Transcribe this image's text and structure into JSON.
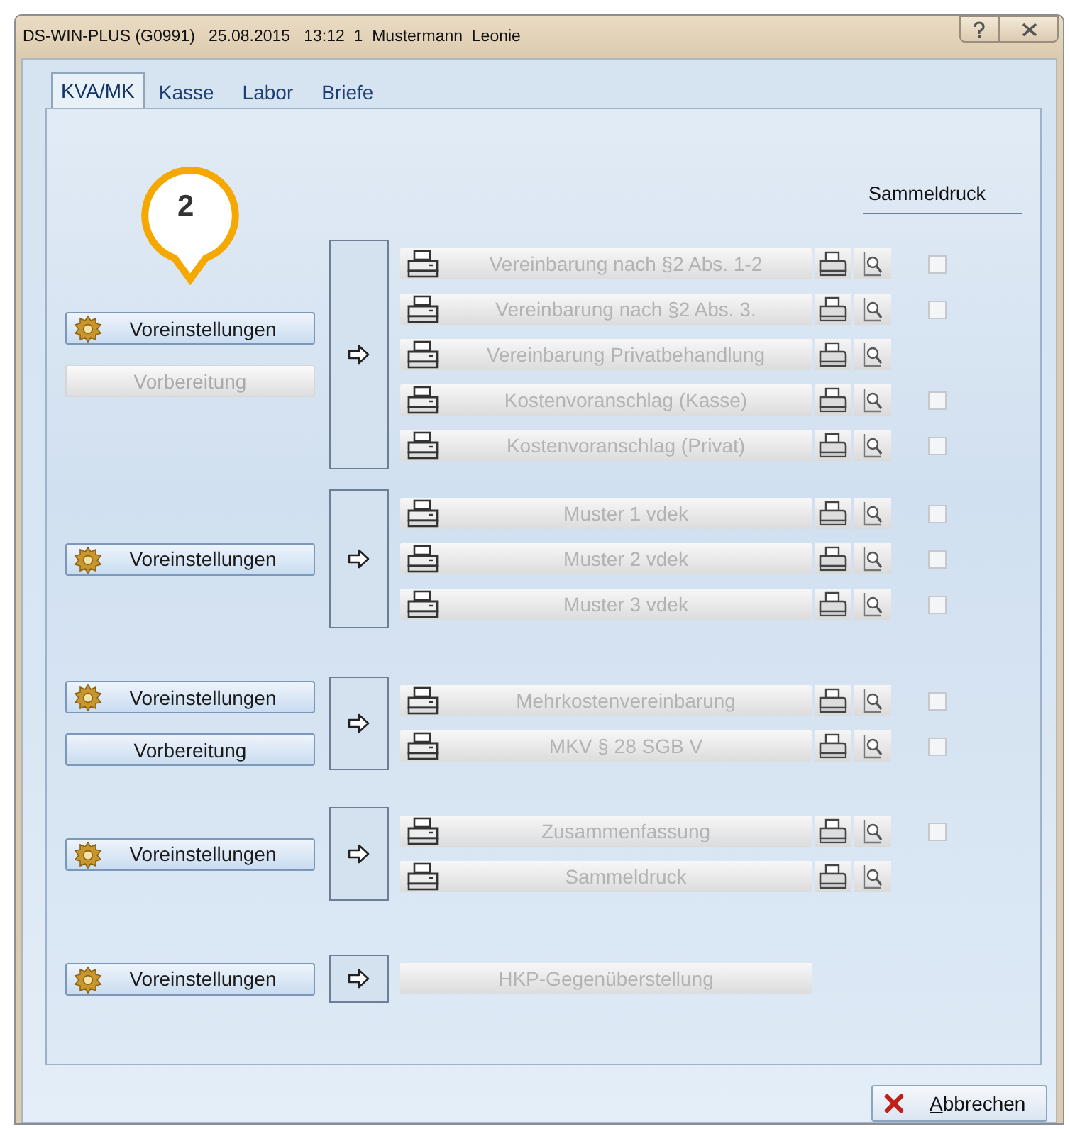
{
  "window": {
    "title": "DS-WIN-PLUS (G0991)   25.08.2015   13:12  1  Mustermann  Leonie"
  },
  "tabs": [
    {
      "label": "KVA/MK",
      "selected": true
    },
    {
      "label": "Kasse",
      "selected": false
    },
    {
      "label": "Labor",
      "selected": false
    },
    {
      "label": "Briefe",
      "selected": false
    }
  ],
  "callout": {
    "text": "2"
  },
  "collective_print_header": "Sammeldruck",
  "groups": [
    {
      "setup_buttons": [
        {
          "kind": "settings",
          "label": "Voreinstellungen",
          "disabled": false
        },
        {
          "kind": "plain",
          "label": "Vorbereitung",
          "disabled": true
        }
      ],
      "documents": [
        {
          "kind": "print",
          "label": "Vereinbarung nach §2 Abs. 1-2",
          "disabled": true,
          "collective_print": {
            "checked": false
          }
        },
        {
          "kind": "print",
          "label": "Vereinbarung nach §2 Abs. 3.",
          "disabled": true,
          "collective_print": {
            "checked": false
          }
        },
        {
          "kind": "print",
          "label": "Vereinbarung Privatbehandlung",
          "disabled": true
        },
        {
          "kind": "print",
          "label": "Kostenvoranschlag (Kasse)",
          "disabled": true,
          "collective_print": {
            "checked": false
          }
        },
        {
          "kind": "print",
          "label": "Kostenvoranschlag (Privat)",
          "disabled": true,
          "collective_print": {
            "checked": false
          }
        }
      ]
    },
    {
      "setup_buttons": [
        {
          "kind": "settings",
          "label": "Voreinstellungen",
          "disabled": false
        }
      ],
      "documents": [
        {
          "kind": "print",
          "label": "Muster 1 vdek",
          "disabled": true,
          "collective_print": {
            "checked": false
          }
        },
        {
          "kind": "print",
          "label": "Muster 2 vdek",
          "disabled": true,
          "collective_print": {
            "checked": false
          }
        },
        {
          "kind": "print",
          "label": "Muster 3 vdek",
          "disabled": true,
          "collective_print": {
            "checked": false
          }
        }
      ]
    },
    {
      "setup_buttons": [
        {
          "kind": "settings",
          "label": "Voreinstellungen",
          "disabled": false
        },
        {
          "kind": "plain",
          "label": "Vorbereitung",
          "disabled": false
        }
      ],
      "documents": [
        {
          "kind": "print",
          "label": "Mehrkostenvereinbarung",
          "disabled": true,
          "collective_print": {
            "checked": false
          }
        },
        {
          "kind": "print",
          "label": "MKV § 28 SGB V",
          "disabled": true,
          "collective_print": {
            "checked": false
          }
        }
      ]
    },
    {
      "setup_buttons": [
        {
          "kind": "settings",
          "label": "Voreinstellungen",
          "disabled": false
        }
      ],
      "documents": [
        {
          "kind": "print",
          "label": "Zusammenfassung",
          "disabled": true,
          "collective_print": {
            "checked": false
          }
        },
        {
          "kind": "print",
          "label": "Sammeldruck",
          "disabled": true
        }
      ]
    },
    {
      "setup_buttons": [
        {
          "kind": "settings",
          "label": "Voreinstellungen",
          "disabled": false
        }
      ],
      "documents": [
        {
          "kind": "plain",
          "label": "HKP-Gegenüberstellung",
          "disabled": true
        }
      ]
    }
  ],
  "cancel_button": {
    "label": "Abbrechen"
  }
}
